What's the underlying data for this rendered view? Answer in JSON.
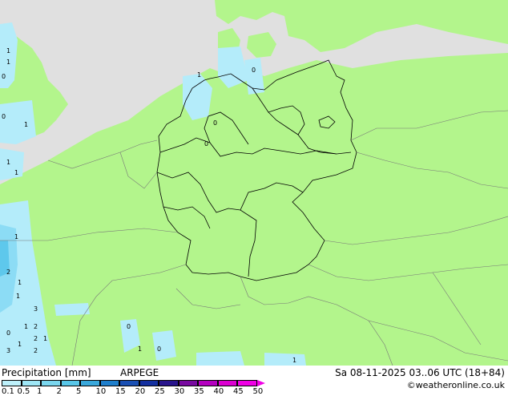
{
  "footer": {
    "title": "Precipitation [mm]",
    "model": "ARPEGE",
    "valid_time": "Sa 08-11-2025 03..06 UTC (18+84)",
    "credit": "©weatheronline.co.uk"
  },
  "legend": {
    "labels": [
      "0.1",
      "0.5",
      "1",
      "2",
      "5",
      "10",
      "15",
      "20",
      "25",
      "30",
      "35",
      "40",
      "45",
      "50"
    ],
    "colors": [
      "#bdf0fa",
      "#9ee6f5",
      "#7ad6ee",
      "#58c6e8",
      "#3aa8dc",
      "#1f7fcc",
      "#1a50b4",
      "#1430a0",
      "#28148c",
      "#780aa0",
      "#b400c0",
      "#dc00d2",
      "#f000e6"
    ]
  },
  "map": {
    "colors": {
      "sea": "#e0e0e0",
      "land": "#b3f58c",
      "rain_light": "#b4ecfa",
      "rain_medium": "#8cdcf5",
      "rain_heavy": "#5ec8ec",
      "border": "#000000"
    },
    "precip_labels": [
      {
        "id": "uk1",
        "text": "1"
      },
      {
        "id": "uk2",
        "text": "1"
      },
      {
        "id": "uk3",
        "text": "0"
      },
      {
        "id": "uk4",
        "text": "1"
      },
      {
        "id": "ch1",
        "text": "1"
      },
      {
        "id": "ch2",
        "text": "0"
      },
      {
        "id": "ch3",
        "text": "1"
      },
      {
        "id": "ch4",
        "text": "1"
      },
      {
        "id": "bi1",
        "text": "2"
      },
      {
        "id": "bi2",
        "text": "1"
      },
      {
        "id": "bi3",
        "text": "1"
      },
      {
        "id": "bi4",
        "text": "3"
      },
      {
        "id": "bi5",
        "text": "2"
      },
      {
        "id": "bi6",
        "text": "1"
      },
      {
        "id": "bi7",
        "text": "0"
      },
      {
        "id": "bi8",
        "text": "1"
      },
      {
        "id": "bi9",
        "text": "2"
      },
      {
        "id": "bi10",
        "text": "1"
      },
      {
        "id": "bi11",
        "text": "3"
      },
      {
        "id": "bi12",
        "text": "2"
      },
      {
        "id": "dk1",
        "text": "1"
      },
      {
        "id": "dk2",
        "text": "0"
      },
      {
        "id": "ger1",
        "text": "0"
      },
      {
        "id": "ger2",
        "text": "0"
      },
      {
        "id": "it1",
        "text": "0"
      },
      {
        "id": "it2",
        "text": "1"
      },
      {
        "id": "it3",
        "text": "0"
      },
      {
        "id": "it4",
        "text": "1"
      }
    ]
  }
}
